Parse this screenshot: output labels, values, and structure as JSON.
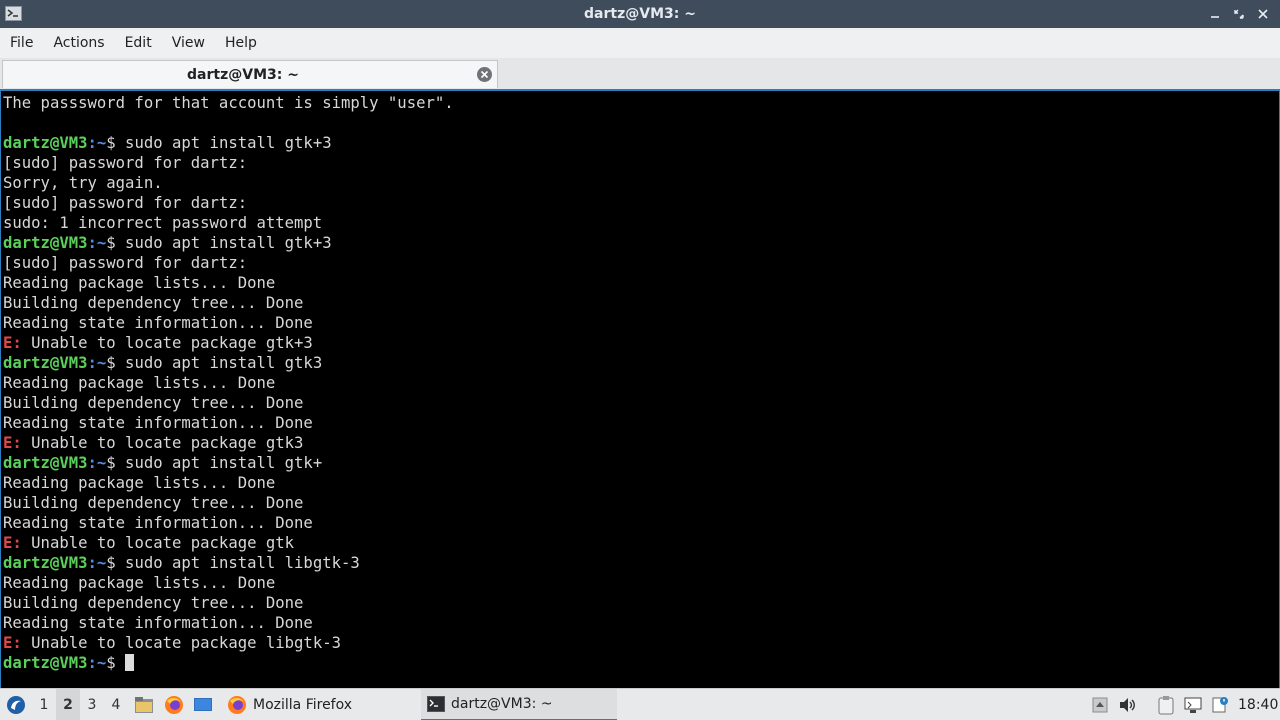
{
  "window": {
    "title": "dartz@VM3: ~"
  },
  "menu": [
    "File",
    "Actions",
    "Edit",
    "View",
    "Help"
  ],
  "tab": {
    "label": "dartz@VM3: ~"
  },
  "terminal": {
    "prompt_user": "dartz@VM3",
    "prompt_path": ":~",
    "prompt_symbol": "$",
    "lines": [
      {
        "type": "text",
        "text": "The passsword for that account is simply \"user\"."
      },
      {
        "type": "text",
        "text": ""
      },
      {
        "type": "prompt",
        "text": " sudo apt install gtk+3"
      },
      {
        "type": "text",
        "text": "[sudo] password for dartz:"
      },
      {
        "type": "text",
        "text": "Sorry, try again."
      },
      {
        "type": "text",
        "text": "[sudo] password for dartz:"
      },
      {
        "type": "text",
        "text": "sudo: 1 incorrect password attempt"
      },
      {
        "type": "prompt",
        "text": " sudo apt install gtk+3"
      },
      {
        "type": "text",
        "text": "[sudo] password for dartz:"
      },
      {
        "type": "text",
        "text": "Reading package lists... Done"
      },
      {
        "type": "text",
        "text": "Building dependency tree... Done"
      },
      {
        "type": "text",
        "text": "Reading state information... Done"
      },
      {
        "type": "error",
        "text": " Unable to locate package gtk+3"
      },
      {
        "type": "prompt",
        "text": " sudo apt install gtk3"
      },
      {
        "type": "text",
        "text": "Reading package lists... Done"
      },
      {
        "type": "text",
        "text": "Building dependency tree... Done"
      },
      {
        "type": "text",
        "text": "Reading state information... Done"
      },
      {
        "type": "error",
        "text": " Unable to locate package gtk3"
      },
      {
        "type": "prompt",
        "text": " sudo apt install gtk+"
      },
      {
        "type": "text",
        "text": "Reading package lists... Done"
      },
      {
        "type": "text",
        "text": "Building dependency tree... Done"
      },
      {
        "type": "text",
        "text": "Reading state information... Done"
      },
      {
        "type": "error",
        "text": " Unable to locate package gtk"
      },
      {
        "type": "prompt",
        "text": " sudo apt install libgtk-3"
      },
      {
        "type": "text",
        "text": "Reading package lists... Done"
      },
      {
        "type": "text",
        "text": "Building dependency tree... Done"
      },
      {
        "type": "text",
        "text": "Reading state information... Done"
      },
      {
        "type": "error",
        "text": " Unable to locate package libgtk-3"
      },
      {
        "type": "prompt-cursor",
        "text": " "
      }
    ],
    "error_prefix": "E:"
  },
  "taskbar": {
    "workspaces": [
      "1",
      "2",
      "3",
      "4"
    ],
    "active_workspace": "2",
    "tasks": [
      {
        "label": "Mozilla Firefox",
        "icon": "firefox-icon",
        "active": false
      },
      {
        "label": "dartz@VM3: ~",
        "icon": "terminal-icon",
        "active": true
      }
    ],
    "clock": "18:40"
  },
  "colors": {
    "titlebar": "#3e4c5c",
    "prompt_user": "#5ad15a",
    "prompt_path": "#4f8fe0",
    "error": "#e24848",
    "accent": "#2a7fbf"
  }
}
